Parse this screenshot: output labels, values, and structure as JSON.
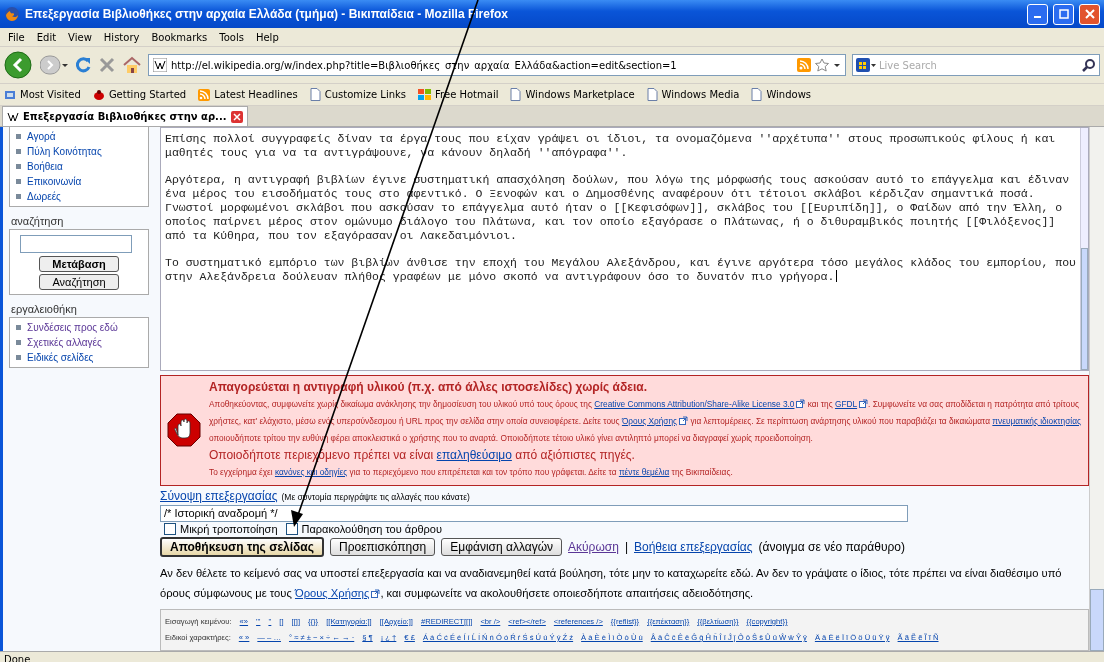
{
  "window": {
    "title": "Επεξεργασία Βιβλιοθήκες στην αρχαία Ελλάδα (τμήμα) - Βικιπαίδεια - Mozilla Firefox"
  },
  "menu": [
    "File",
    "Edit",
    "View",
    "History",
    "Bookmarks",
    "Tools",
    "Help"
  ],
  "address": {
    "value": "http://el.wikipedia.org/w/index.php?title=Βιβλιοθήκες_στην_αρχαία_Ελλάδα&action=edit&section=1"
  },
  "search": {
    "placeholder": "Live Search"
  },
  "bookmarks": [
    {
      "label": "Most Visited",
      "kind": "smart"
    },
    {
      "label": "Getting Started",
      "kind": "firefox"
    },
    {
      "label": "Latest Headlines",
      "kind": "feed"
    },
    {
      "label": "Customize Links",
      "kind": "page"
    },
    {
      "label": "Free Hotmail",
      "kind": "windows"
    },
    {
      "label": "Windows Marketplace",
      "kind": "page"
    },
    {
      "label": "Windows Media",
      "kind": "page"
    },
    {
      "label": "Windows",
      "kind": "page"
    }
  ],
  "tabs": [
    {
      "label": "Επεξεργασία Βιβλιοθήκες στην αρ...",
      "selected": true
    }
  ],
  "sidebar": {
    "nav_items": [
      {
        "label": "Αγορά",
        "visited": false
      },
      {
        "label": "Πύλη Κοινότητας",
        "visited": false
      },
      {
        "label": "Βοήθεια",
        "visited": false
      },
      {
        "label": "Επικοινωνία",
        "visited": false
      },
      {
        "label": "Δωρεές",
        "visited": false
      }
    ],
    "search_title": "αναζήτηση",
    "go_button": "Μετάβαση",
    "search_button": "Αναζήτηση",
    "tools_title": "εργαλειοθήκη",
    "tools_items": [
      {
        "label": "Συνδέσεις προς εδώ",
        "visited": true
      },
      {
        "label": "Σχετικές αλλαγές",
        "visited": true
      },
      {
        "label": "Ειδικές σελίδες",
        "visited": false
      }
    ]
  },
  "editor": {
    "paragraphs": [
      [
        "Επίσης πολλοί συγγραφείς δίναν τα έργα τους που είχαν γράψει οι ίδιοι, τα ονομαζόμενα ''αρχέτυπα'' στους προσωπικούς φίλους ή και",
        "μαθητές τους για να τα αντιγράψουνε, να κάνουν δηλαδή ''απόγραφα''."
      ],
      [
        "Αργότερα, η αντιγραφή βιβλίων έγινε συστηματική απασχόληση δούλων, που λόγω της μόρφωσής τους ασκούσαν αυτό το επάγγελμα και έδιναν",
        "ένα μέρος του εισοδήματός τους στο αφεντικό. Ο Ξενοφών και ο Δημοσθένης αναφέρουν ότι τέτοιοι σκλάβοι κέρδιζαν σημαντικά ποσά.",
        "Γνωστοί μορφωμένοι σκλάβοι που ασκούσαν το επάγγελμα αυτό ήταν ο [[Κεφισόφων]], σκλάβος του [[Ευριπίδη]], ο Φαίδων από την Έλλη, ο",
        "οποίος παίρνει μέρος στον ομώνυμο διάλογο του Πλάτωνα, και τον οποίο εξαγόρασε ο Πλάτωνας, ή ο διθυραμβικός ποιητής [[Φιλόξενος]]",
        "από τα Κύθηρα, που τον εξαγόρασαν οι Λακεδαιμόνιοι."
      ],
      [
        "Το συστηματικό εμπόριο των βιβλίων άνθισε την εποχή του Μεγάλου Αλεξάνδρου, και έγινε αργότερα τόσο μεγάλος κλάδος του εμπορίου, που",
        "στην Αλεξάνδρεια δούλευαν πλήθος γραφέων με μόνο σκοπό να αντιγράφουν όσο το δυνατόν πιο γρήγορα."
      ]
    ]
  },
  "warning": {
    "title": "Απαγορεύεται η αντιγραφή υλικού (π.χ. από άλλες ιστοσελίδες) χωρίς άδεια.",
    "paragraphs": [
      {
        "kind": "small",
        "segments": [
          {
            "kind": "text",
            "text": "Αποθηκεύοντας, συμφωνείτε χωρίς δικαίωμα ανάκλησης την δημοσίευση του υλικού υπό τους όρους της "
          },
          {
            "kind": "external",
            "text": "Creative Commons Attribution/Share-Alike License 3.0"
          },
          {
            "kind": "text",
            "text": " και της "
          },
          {
            "kind": "external",
            "text": "GFDL"
          },
          {
            "kind": "text",
            "text": ". Συμφωνείτε να σας αποδίδεται η πατρότητα από τρίτους χρήστες, κατ' ελάχιστο, μέσω ενός υπερσύνδεσμου ή URL προς την σελίδα στην οποία συνεισφέρετε. Δείτε τους "
          },
          {
            "kind": "external",
            "text": "Όρους Χρήσης"
          },
          {
            "kind": "text",
            "text": " για λεπτομέρειες. Σε περίπτωση ανάρτησης υλικού που παραβιάζει τα δικαιώματα "
          },
          {
            "kind": "link",
            "text": "πνευματικής ιδιοκτησίας"
          },
          {
            "kind": "text",
            "text": " οποιουδήποτε τρίτου την ευθύνη φέρει αποκλειστικά ο χρήστης που το αναρτά. Οποιοδήποτε τέτοιο υλικό γίνει αντιληπτό μπορεί να διαγραφεί χωρίς προειδοποίηση."
          }
        ]
      },
      {
        "kind": "large",
        "segments": [
          {
            "kind": "text",
            "text": "Οποιοδήποτε περιεχόμενο πρέπει να είναι "
          },
          {
            "kind": "link",
            "text": "επαληθεύσιμο"
          },
          {
            "kind": "text",
            "text": " από αξιόπιστες πηγές."
          }
        ]
      },
      {
        "kind": "small",
        "segments": [
          {
            "kind": "text",
            "text": "Το εγχείρημα έχει "
          },
          {
            "kind": "link",
            "text": "κανόνες και οδηγίες"
          },
          {
            "kind": "text",
            "text": " για το περιεχόμενο που επιτρέπεται και τον τρόπο που γράφεται. Δείτε τα "
          },
          {
            "kind": "link",
            "text": "πέντε θεμέλια"
          },
          {
            "kind": "text",
            "text": " της Βικιπαίδειας."
          }
        ]
      }
    ]
  },
  "summary": {
    "label": "Σύνοψη επεξεργασίας",
    "hint": "(Με συντομία περιγράψτε τις αλλαγές που κάνατε)",
    "value": "/* Ιστορική αναδρομή */"
  },
  "checkboxes": [
    {
      "label": "Μικρή τροποποίηση",
      "checked": false
    },
    {
      "label": "Παρακολούθηση του άρθρου",
      "checked": false
    }
  ],
  "buttons": [
    {
      "label": "Αποθήκευση της σελίδας",
      "kind": "primary"
    },
    {
      "label": "Προεπισκόπηση",
      "kind": "normal"
    },
    {
      "label": "Εμφάνιση αλλαγών",
      "kind": "normal"
    }
  ],
  "cancel_link": "Ακύρωση",
  "separator": "|",
  "help_link": "Βοήθεια επεξεργασίας",
  "help_note": "(άνοιγμα σε νέο παράθυρο)",
  "notice": {
    "segments": [
      {
        "kind": "text",
        "text": "Αν δεν θέλετε το κείμενό σας να υποστεί επεξεργασία και να αναδιανεμηθεί κατά βούληση, τότε μην το καταχωρείτε εδώ. Αν δεν το γράψατε ο ίδιος, τότε πρέπει να είναι διαθέσιμο υπό όρους σύμφωνους με τους "
      },
      {
        "kind": "external",
        "text": "Όρους Χρήσης"
      },
      {
        "kind": "text",
        "text": ", και συμφωνείτε να ακολουθήσετε οποιεσδήποτε απαιτήσεις αδειοδότησης."
      }
    ]
  },
  "insert": {
    "label": "Εισαγωγή κειμένου:",
    "items": [
      "«»",
      "'''",
      "''",
      "[]",
      "[[]]",
      "{{}}",
      "[[Κατηγορία:]]",
      "[[Αρχείο:]]",
      "#REDIRECT[[]]",
      "<br />",
      "<ref></ref>",
      "<references />",
      "{{reflist}}",
      "{{επέκταση}}",
      "{{βελτίωση}}",
      "{{copyright}}"
    ]
  },
  "special": {
    "label": "Ειδικοί χαρακτήρες:",
    "items": [
      "« »",
      "— – …",
      "° ≈ ≠ ± − × ÷ ← → ·",
      "§ ¶",
      "¡ ¿ †",
      "€ £",
      "Á á Ć ć É é Í í Ĺ ĺ Ń ń Ó ó Ŕ ŕ Ś ś Ú ú Ý ý Ź ź",
      "À à È è Ì ì Ò ò Ù ù",
      "Â â Ĉ ĉ Ê ê Ĝ ĝ Ĥ ĥ Î î Ĵ ĵ Ô ô Ŝ ŝ Û û Ŵ ŵ Ŷ ŷ",
      "Ä ä Ë ë Ï ï Ö ö Ü ü Ÿ ÿ",
      "Ã ã Ẽ ẽ Ĩ ĩ Ñ"
    ]
  },
  "status_bar": "Done"
}
